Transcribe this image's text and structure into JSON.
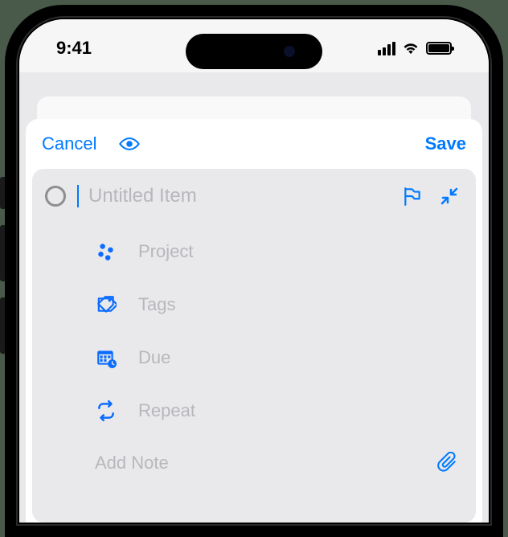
{
  "status": {
    "time": "9:41"
  },
  "modal": {
    "cancel_label": "Cancel",
    "save_label": "Save"
  },
  "item": {
    "title_placeholder": "Untitled Item",
    "title_value": ""
  },
  "fields": {
    "project": {
      "label": "Project"
    },
    "tags": {
      "label": "Tags"
    },
    "due": {
      "label": "Due"
    },
    "repeat": {
      "label": "Repeat"
    }
  },
  "note": {
    "placeholder": "Add Note"
  }
}
